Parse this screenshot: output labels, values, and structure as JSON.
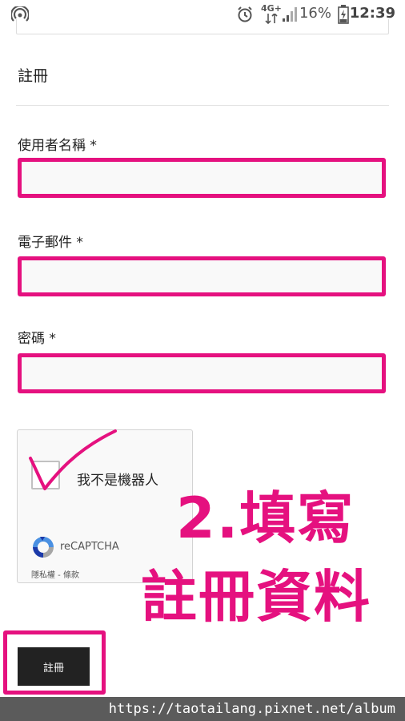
{
  "status_bar": {
    "network_label": "4G+",
    "battery_percent": "16%",
    "time": "12:39"
  },
  "form": {
    "section_title": "註冊",
    "fields": [
      {
        "label": "使用者名稱 *",
        "value": "",
        "placeholder": ""
      },
      {
        "label": "電子郵件 *",
        "value": "",
        "placeholder": ""
      },
      {
        "label": "密碼 *",
        "value": "",
        "placeholder": ""
      }
    ],
    "captcha": {
      "label": "我不是機器人",
      "brand": "reCAPTCHA",
      "privacy_terms": "隱私權 - 條款"
    },
    "submit_label": "註冊"
  },
  "annotation": {
    "line1": "2.填寫",
    "line2": "註冊資料",
    "color": "#e5117f"
  },
  "watermark": "https://taotailang.pixnet.net/album"
}
